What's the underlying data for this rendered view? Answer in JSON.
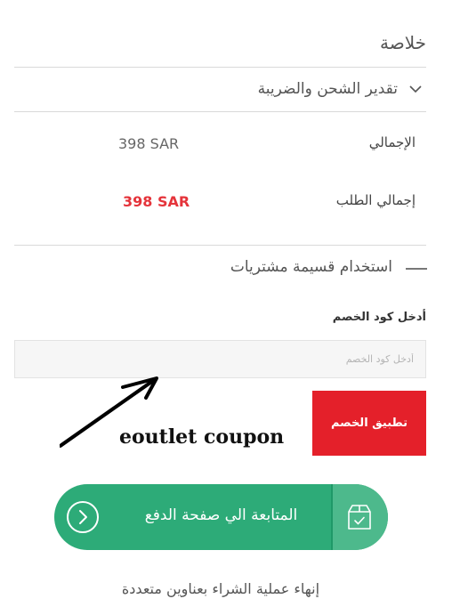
{
  "summary": {
    "title": "خلاصة"
  },
  "shipping": {
    "label": "تقدير الشحن والضريبة"
  },
  "totals": {
    "subtotal_label": "الإجمالي",
    "subtotal_value": "398 SAR",
    "grand_total_label": "إجمالي الطلب",
    "grand_total_value": "398 SAR"
  },
  "coupon": {
    "toggle_label": "استخدام قسيمة مشتريات",
    "field_label": "أدخل كود الخصم",
    "placeholder": "أدخل كود الخصم",
    "apply_label": "تطبيق الخصم"
  },
  "annotation": {
    "text": "eoutlet coupon"
  },
  "checkout": {
    "label": "المتابعة الي صفحة الدفع"
  },
  "multi_address": {
    "label": "إنهاء عملية الشراء بعناوين متعددة"
  },
  "colors": {
    "accent_red": "#e4202a",
    "total_red": "#e5343b",
    "checkout_green": "#2dab78",
    "checkout_icon_green": "#4db98c"
  },
  "icons": [
    "chevron-down-icon",
    "minus-icon",
    "arrow-right-circle-icon",
    "box-check-icon"
  ]
}
